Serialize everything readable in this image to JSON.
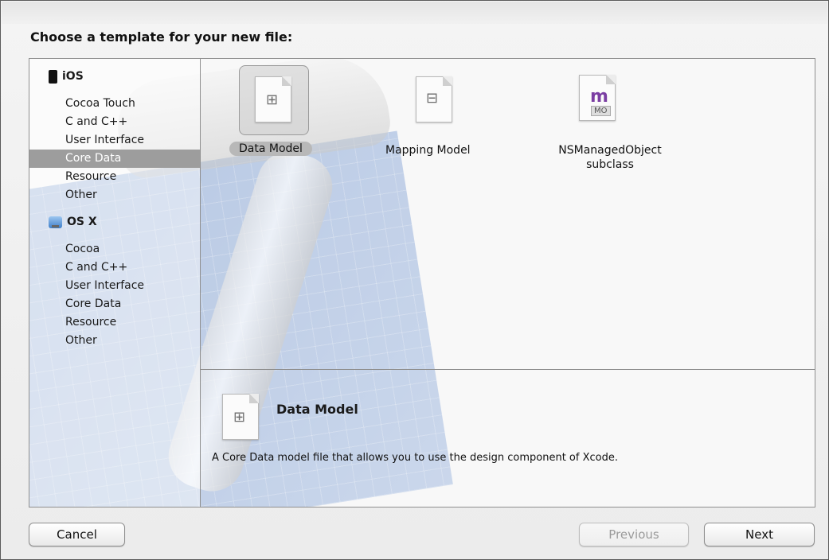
{
  "dialog": {
    "title": "Choose a template for your new file:"
  },
  "sidebar": {
    "sections": [
      {
        "name": "iOS",
        "icon": "iphone-icon",
        "items": [
          {
            "label": "Cocoa Touch",
            "selected": false
          },
          {
            "label": "C and C++",
            "selected": false
          },
          {
            "label": "User Interface",
            "selected": false
          },
          {
            "label": "Core Data",
            "selected": true
          },
          {
            "label": "Resource",
            "selected": false
          },
          {
            "label": "Other",
            "selected": false
          }
        ]
      },
      {
        "name": "OS X",
        "icon": "mac-icon",
        "items": [
          {
            "label": "Cocoa",
            "selected": false
          },
          {
            "label": "C and C++",
            "selected": false
          },
          {
            "label": "User Interface",
            "selected": false
          },
          {
            "label": "Core Data",
            "selected": false
          },
          {
            "label": "Resource",
            "selected": false
          },
          {
            "label": "Other",
            "selected": false
          }
        ]
      }
    ]
  },
  "templates": [
    {
      "label": "Data Model",
      "icon": "data-model-file-icon",
      "selected": true
    },
    {
      "label": "Mapping Model",
      "icon": "mapping-model-file-icon",
      "selected": false
    },
    {
      "label_line1": "NSManagedObject",
      "label_line2": "subclass",
      "icon": "managed-object-file-icon",
      "icon_badge": "MO",
      "selected": false
    }
  ],
  "description": {
    "title": "Data Model",
    "text": "A Core Data model file that allows you to use the design component of Xcode."
  },
  "buttons": {
    "cancel": "Cancel",
    "previous": "Previous",
    "next": "Next"
  },
  "colors": {
    "selection": "#9d9d9d",
    "border": "#8f8f8f"
  }
}
